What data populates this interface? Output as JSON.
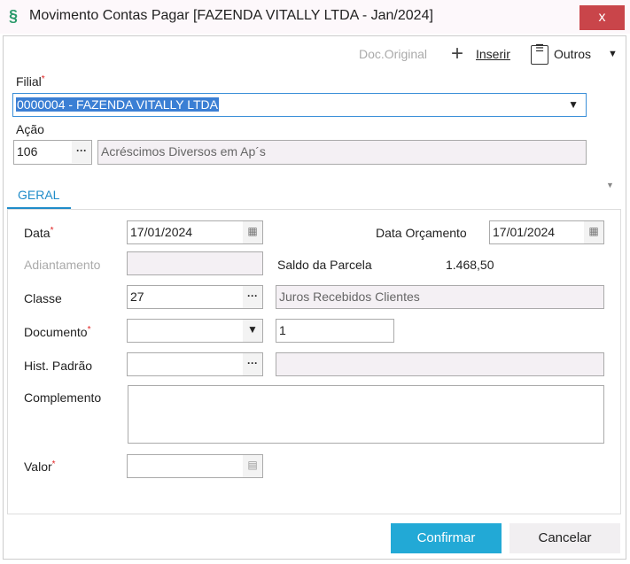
{
  "window": {
    "title": "Movimento Contas Pagar [FAZENDA VITALLY LTDA - Jan/2024]",
    "close": "x"
  },
  "toolbar": {
    "doc_original": "Doc.Original",
    "inserir": "Inserir",
    "outros": "Outros"
  },
  "filial": {
    "label": "Filial",
    "value": "0000004 - FAZENDA VITALLY LTDA"
  },
  "acao": {
    "label": "Ação",
    "code": "106",
    "description": "Acréscimos Diversos em Ap´s"
  },
  "tabs": [
    {
      "label": "GERAL",
      "active": true
    }
  ],
  "form": {
    "data": {
      "label": "Data",
      "value": "17/01/2024"
    },
    "data_orcamento": {
      "label": "Data Orçamento",
      "value": "17/01/2024"
    },
    "adiantamento": {
      "label": "Adiantamento",
      "value": ""
    },
    "saldo": {
      "label": "Saldo da Parcela",
      "value": "1.468,50"
    },
    "classe": {
      "label": "Classe",
      "code": "27",
      "description": "Juros Recebidos Clientes"
    },
    "documento": {
      "label": "Documento",
      "type": "",
      "number": "1"
    },
    "hist_padrao": {
      "label": "Hist. Padrão",
      "code": "",
      "description": ""
    },
    "complemento": {
      "label": "Complemento",
      "value": ""
    },
    "valor": {
      "label": "Valor",
      "value": ""
    }
  },
  "buttons": {
    "confirm": "Confirmar",
    "cancel": "Cancelar"
  },
  "colors": {
    "accent": "#22a9d6",
    "close": "#c9454a",
    "selection": "#3b7fd4"
  }
}
